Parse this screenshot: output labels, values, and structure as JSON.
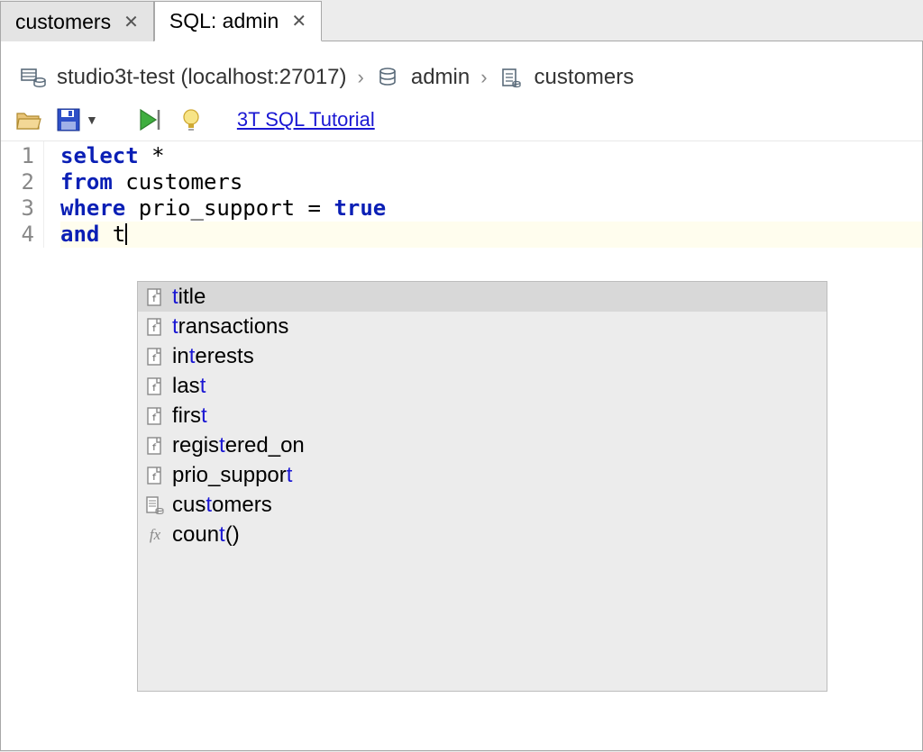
{
  "tabs": [
    {
      "label": "customers",
      "active": false
    },
    {
      "label": "SQL: admin",
      "active": true
    }
  ],
  "breadcrumb": {
    "connection": "studio3t-test (localhost:27017)",
    "database": "admin",
    "collection": "customers"
  },
  "toolbar": {
    "tutorial_label": "3T SQL Tutorial"
  },
  "editor": {
    "lines": [
      {
        "n": "1"
      },
      {
        "n": "2"
      },
      {
        "n": "3"
      },
      {
        "n": "4"
      }
    ],
    "code": {
      "kw_select": "select",
      "star": " *",
      "kw_from": "from",
      "tbl": " customers",
      "kw_where": "where",
      "cond": " prio_support = ",
      "kw_true": "true",
      "kw_and": "and",
      "typed": " t"
    }
  },
  "autocomplete": {
    "items": [
      {
        "type": "field",
        "pre": "",
        "hl": "t",
        "post": "itle",
        "selected": true
      },
      {
        "type": "field",
        "pre": "",
        "hl": "t",
        "post": "ransactions",
        "selected": false
      },
      {
        "type": "field",
        "pre": "in",
        "hl": "t",
        "post": "erests",
        "selected": false
      },
      {
        "type": "field",
        "pre": "las",
        "hl": "t",
        "post": "",
        "selected": false
      },
      {
        "type": "field",
        "pre": "firs",
        "hl": "t",
        "post": "",
        "selected": false
      },
      {
        "type": "field",
        "pre": "regis",
        "hl": "t",
        "post": "ered_on",
        "selected": false
      },
      {
        "type": "field",
        "pre": "prio_suppor",
        "hl": "t",
        "post": "",
        "selected": false
      },
      {
        "type": "collection",
        "pre": "cus",
        "hl": "t",
        "post": "omers",
        "selected": false
      },
      {
        "type": "function",
        "pre": "coun",
        "hl": "t",
        "post": "()",
        "selected": false
      }
    ]
  }
}
